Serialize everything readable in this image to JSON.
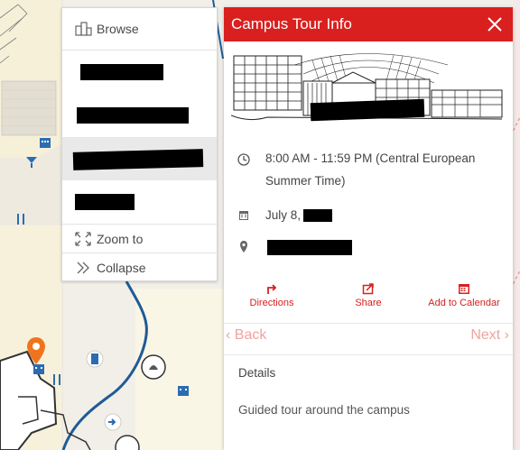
{
  "menu": {
    "browse_label": "Browse",
    "zoom_label": "Zoom to",
    "collapse_label": "Collapse"
  },
  "panel": {
    "title": "Campus Tour Info",
    "time_text_line1": "8:00 AM - 11:59 PM (Central European",
    "time_text_line2": "Summer Time)",
    "date_text": "July 8,",
    "actions": {
      "directions": "Directions",
      "share": "Share",
      "calendar": "Add to Calendar"
    },
    "nav": {
      "back": "Back",
      "next": "Next"
    },
    "details_label": "Details",
    "details_text": "Guided tour around the campus"
  },
  "colors": {
    "accent": "#d9201f",
    "map_pin": "#f0741e",
    "path": "#1f5b96"
  },
  "icons": {
    "browse": "building-icon",
    "zoom": "zoom-to-icon",
    "collapse": "double-chevron-icon",
    "close": "close-icon",
    "time": "clock-icon",
    "date": "calendar-icon",
    "location": "location-pin-icon",
    "directions": "directions-icon",
    "share": "share-icon",
    "calendar": "add-calendar-icon"
  }
}
